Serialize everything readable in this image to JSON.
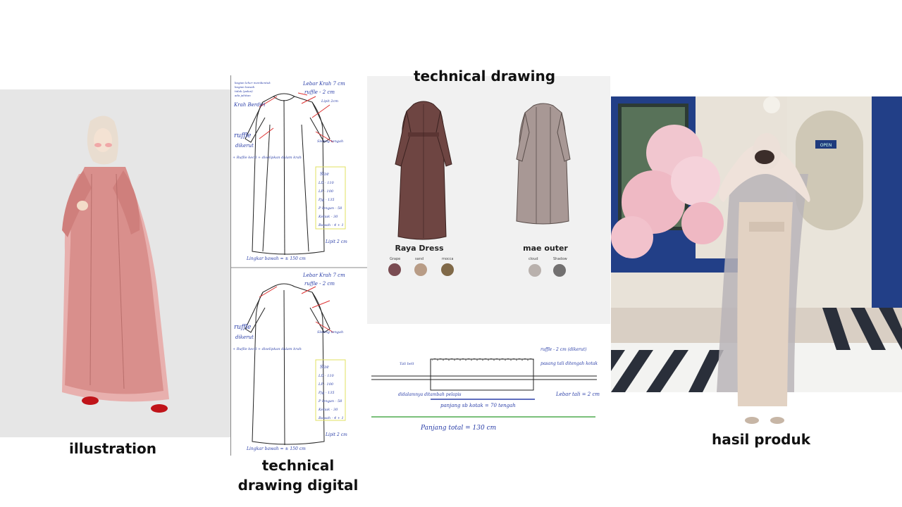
{
  "captions": {
    "illustration": "illustration",
    "technical_digital": "technical drawing digital",
    "technical_drawing": "technical drawing",
    "hasil_produk": "hasil produk"
  },
  "sketch": {
    "notes_top": [
      "bagian leher membentuk",
      "bagian bawah",
      "tidak (pakai)",
      "ada jahitan"
    ],
    "lebar_krah": "Lebar Krah 7 cm",
    "ruffle_top": "ruffle - 2 cm",
    "lipit": "Lipit 2cm",
    "krah": "Krah Berdiri",
    "ruffle": "ruffle",
    "diberi": "dikerut",
    "diselipkan": "+ Ruflle kecil + diselipkan dalam krah",
    "sisi": "Sleting tengah",
    "size_title": "Size",
    "size_items": [
      "LD - 110",
      "LP - 100",
      "Pjg - 135",
      "P lengan - 58",
      "Ketiak - 30",
      "Bawah - 4 + 1"
    ],
    "bottom_note": "Lingkar bawah = ± 150 cm",
    "lipit_bottom": "Lipit 2 cm"
  },
  "products": [
    {
      "name": "Raya Dress",
      "swatches": [
        {
          "label": "Grape",
          "color": "#7a4c52"
        },
        {
          "label": "sand",
          "color": "#b89c86"
        },
        {
          "label": "mocca",
          "color": "#806948"
        }
      ]
    },
    {
      "name": "mae outer",
      "swatches": [
        {
          "label": "cloud",
          "color": "#b9b1ad"
        },
        {
          "label": "Shadow",
          "color": "#727070"
        }
      ]
    }
  ],
  "belt_sketch": {
    "left_note": "Tali belt",
    "top_note": "ruffle - 2 cm (dikerut)",
    "right_note": "pasang tali ditengah kotak",
    "left_bottom": "didalamnya ditambah pelapis",
    "mid_note": "panjang sb kotak = 70 tengah",
    "lebar_tali": "Lebar tali = 2 cm",
    "total": "Panjang total = 130 cm"
  },
  "photo_sign": "OPEN",
  "colors": {
    "dress_pink": "#d98f8c",
    "dress_brown": "#6e4542",
    "outer_taupe": "#a89895",
    "ink_blue": "#2a3ea8",
    "door_blue": "#223f87"
  }
}
